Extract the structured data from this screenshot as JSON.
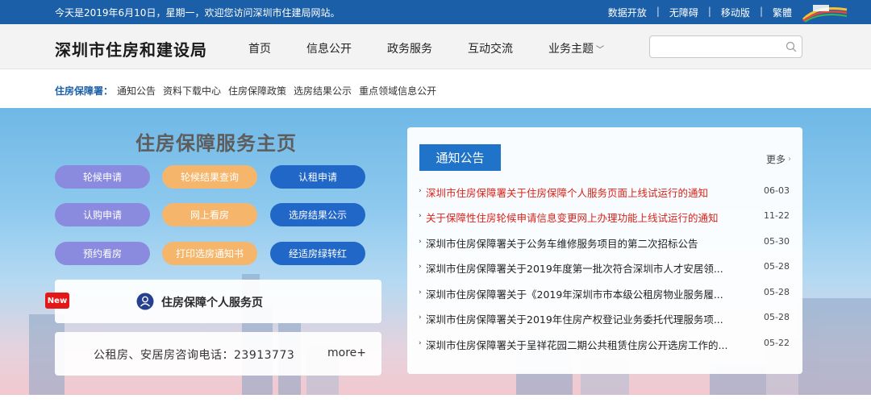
{
  "topbar": {
    "greeting": "今天是2019年6月10日，星期一，欢迎您访问深圳市住建局网站。",
    "links": [
      "数据开放",
      "无障碍",
      "移动版",
      "繁體"
    ]
  },
  "header": {
    "site_title": "深圳市住房和建设局",
    "nav": [
      "首页",
      "信息公开",
      "政务服务",
      "互动交流",
      "业务主题"
    ],
    "search_placeholder": ""
  },
  "subnav": {
    "lead": "住房保障署：",
    "links": [
      "通知公告",
      "资料下载中心",
      "住房保障政策",
      "选房结果公示",
      "重点领域信息公开"
    ]
  },
  "hero": {
    "title": "住房保障服务主页",
    "buttons": [
      [
        "轮候申请",
        "轮候结果查询",
        "认租申请"
      ],
      [
        "认购申请",
        "网上看房",
        "选房结果公示"
      ],
      [
        "预约看房",
        "打印选房通知书",
        "经适房绿转红"
      ]
    ],
    "new_badge": "New",
    "service_link": "住房保障个人服务页",
    "phone_text": "公租房、安居房咨询电话：23913773",
    "phone_more": "more+"
  },
  "notice": {
    "tab": "通知公告",
    "more": "更多",
    "items": [
      {
        "title": "深圳市住房保障署关于住房保障个人服务页面上线试运行的通知",
        "date": "06-03",
        "hot": true
      },
      {
        "title": "关于保障性住房轮候申请信息变更网上办理功能上线试运行的通知",
        "date": "11-22",
        "hot": true
      },
      {
        "title": "深圳市住房保障署关于公务车维修服务项目的第二次招标公告",
        "date": "05-30",
        "hot": false
      },
      {
        "title": "深圳市住房保障署关于2019年度第一批次符合深圳市人才安居领...",
        "date": "05-28",
        "hot": false
      },
      {
        "title": "深圳市住房保障署关于《2019年深圳市市本级公租房物业服务履...",
        "date": "05-28",
        "hot": false
      },
      {
        "title": "深圳市住房保障署关于2019年住房产权登记业务委托代理服务项...",
        "date": "05-28",
        "hot": false
      },
      {
        "title": "深圳市住房保障署关于呈祥花园二期公共租赁住房公开选房工作的...",
        "date": "05-22",
        "hot": false
      }
    ]
  },
  "colors": {
    "topbar": "#1b5fa8",
    "hot_text": "#d8231a",
    "btn_purple": "#8a8bdf",
    "btn_orange": "#f5b66b",
    "btn_blue": "#2067c7",
    "notice_tab": "#1f73c9"
  }
}
